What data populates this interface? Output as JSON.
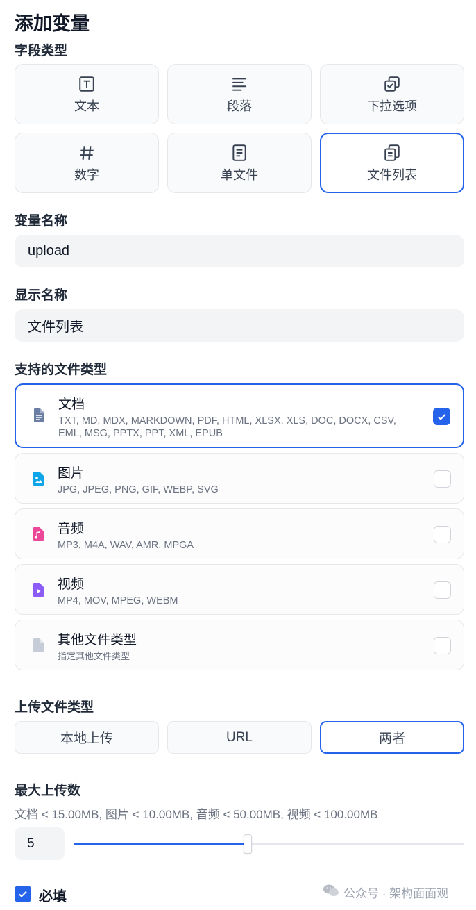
{
  "title": "添加变量",
  "field_type": {
    "label": "字段类型",
    "options": [
      {
        "label": "文本",
        "icon": "text-box-icon"
      },
      {
        "label": "段落",
        "icon": "paragraph-lines-icon"
      },
      {
        "label": "下拉选项",
        "icon": "select-check-icon"
      },
      {
        "label": "数字",
        "icon": "hash-icon"
      },
      {
        "label": "单文件",
        "icon": "single-file-icon"
      },
      {
        "label": "文件列表",
        "icon": "file-list-icon"
      }
    ],
    "selected": "文件列表"
  },
  "variable_name": {
    "label": "变量名称",
    "value": "upload"
  },
  "display_name": {
    "label": "显示名称",
    "value": "文件列表"
  },
  "file_types": {
    "label": "支持的文件类型",
    "items": [
      {
        "name": "文档",
        "exts": "TXT, MD, MDX, MARKDOWN, PDF, HTML, XLSX, XLS, DOC, DOCX, CSV, EML, MSG, PPTX, PPT, XML, EPUB",
        "checked": true,
        "icon": "document-icon",
        "color": "#6b7ea3"
      },
      {
        "name": "图片",
        "exts": "JPG, JPEG, PNG, GIF, WEBP, SVG",
        "checked": false,
        "icon": "image-icon",
        "color": "#0ea5e9"
      },
      {
        "name": "音频",
        "exts": "MP3, M4A, WAV, AMR, MPGA",
        "checked": false,
        "icon": "audio-icon",
        "color": "#ec4899"
      },
      {
        "name": "视频",
        "exts": "MP4, MOV, MPEG, WEBM",
        "checked": false,
        "icon": "video-icon",
        "color": "#8b5cf6"
      },
      {
        "name": "其他文件类型",
        "exts": "指定其他文件类型",
        "checked": false,
        "icon": "other-file-icon",
        "color": "#c7ccd9"
      }
    ]
  },
  "upload_method": {
    "label": "上传文件类型",
    "options": [
      "本地上传",
      "URL",
      "两者"
    ],
    "selected": "两者"
  },
  "max_upload": {
    "label": "最大上传数",
    "limits": "文档 < 15.00MB, 图片 < 10.00MB, 音频 < 50.00MB, 视频 < 100.00MB",
    "value": "5",
    "slider_fraction": 0.445
  },
  "required": {
    "label": "必填",
    "checked": true
  },
  "watermark": "公众号 · 架构面面观",
  "colors": {
    "accent": "#2563eb"
  }
}
